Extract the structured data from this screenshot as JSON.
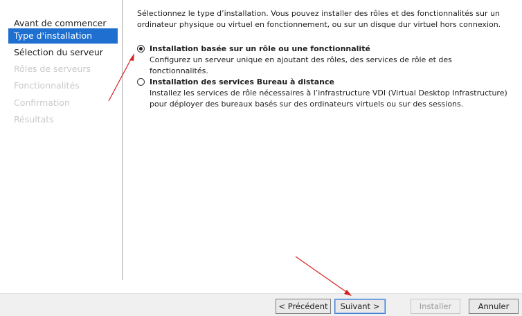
{
  "sidebar": {
    "items": [
      {
        "label": "Avant de commencer",
        "state": "normal"
      },
      {
        "label": "Type d'installation",
        "state": "active"
      },
      {
        "label": "Sélection du serveur",
        "state": "normal"
      },
      {
        "label": "Rôles de serveurs",
        "state": "disabled"
      },
      {
        "label": "Fonctionnalités",
        "state": "disabled"
      },
      {
        "label": "Confirmation",
        "state": "disabled"
      },
      {
        "label": "Résultats",
        "state": "disabled"
      }
    ]
  },
  "main": {
    "intro": "Sélectionnez le type d’installation. Vous pouvez installer des rôles et des fonctionnalités sur un ordinateur physique ou virtuel en fonctionnement, ou sur un disque dur virtuel hors connexion.",
    "options": [
      {
        "title": "Installation basée sur un rôle ou une fonctionnalité",
        "description": "Configurez un serveur unique en ajoutant des rôles, des services de rôle et des fonctionnalités.",
        "selected": true
      },
      {
        "title": "Installation des services Bureau à distance",
        "description": "Installez les services de rôle nécessaires à l’infrastructure VDI (Virtual Desktop Infrastructure) pour déployer des bureaux basés sur des ordinateurs virtuels ou sur des sessions.",
        "selected": false
      }
    ]
  },
  "footer": {
    "previous_label": "< Précédent",
    "next_label": "Suivant >",
    "install_label": "Installer",
    "cancel_label": "Annuler"
  },
  "colors": {
    "active_item_bg": "#1e6fd0",
    "annotation_arrow": "#d62020"
  }
}
